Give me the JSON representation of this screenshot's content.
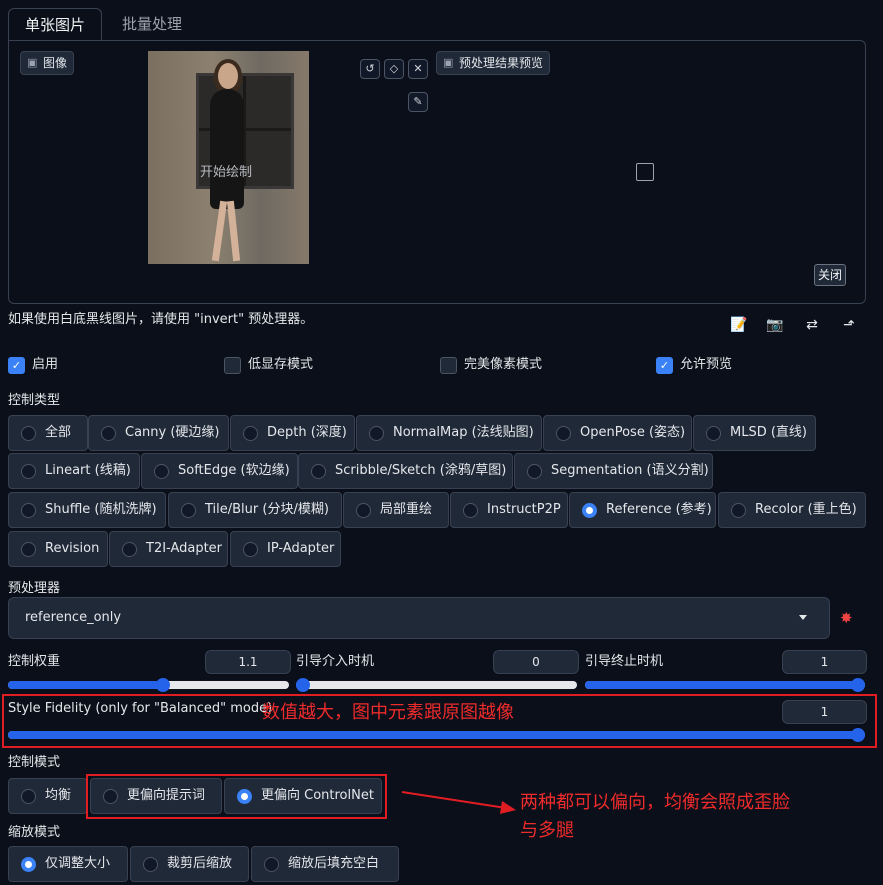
{
  "tabs": [
    "单张图片",
    "批量处理"
  ],
  "image_panel": {
    "label": "图像",
    "overlay_text": "开始绘制",
    "preview_label": "预处理结果预览",
    "close_label": "关闭"
  },
  "hint": "如果使用白底黑线图片，请使用 \"invert\" 预处理器。",
  "checkboxes": [
    {
      "label": "启用",
      "checked": true
    },
    {
      "label": "低显存模式",
      "checked": false
    },
    {
      "label": "完美像素模式",
      "checked": false
    },
    {
      "label": "允许预览",
      "checked": true
    }
  ],
  "control_type": {
    "label": "控制类型",
    "options": [
      "全部",
      "Canny (硬边缘)",
      "Depth (深度)",
      "NormalMap (法线贴图)",
      "OpenPose (姿态)",
      "MLSD (直线)",
      "Lineart (线稿)",
      "SoftEdge (软边缘)",
      "Scribble/Sketch (涂鸦/草图)",
      "Segmentation (语义分割)",
      "Shuffle (随机洗牌)",
      "Tile/Blur (分块/模糊)",
      "局部重绘",
      "InstructP2P",
      "Reference (参考)",
      "Recolor (重上色)",
      "Revision",
      "T2I-Adapter",
      "IP-Adapter"
    ],
    "selected": "Reference (参考)"
  },
  "preprocessor": {
    "label": "预处理器",
    "value": "reference_only"
  },
  "sliders": {
    "weight": {
      "label": "控制权重",
      "value": "1.1",
      "fraction": 0.55
    },
    "start": {
      "label": "引导介入时机",
      "value": "0",
      "fraction": 0.0
    },
    "end": {
      "label": "引导终止时机",
      "value": "1",
      "fraction": 1.0
    },
    "fidelity": {
      "label": "Style Fidelity (only for \"Balanced\" mode)",
      "value": "1",
      "fraction": 1.0
    }
  },
  "control_mode": {
    "label": "控制模式",
    "options": [
      "均衡",
      "更偏向提示词",
      "更偏向 ControlNet"
    ],
    "selected": "更偏向 ControlNet"
  },
  "resize_mode": {
    "label": "缩放模式",
    "options": [
      "仅调整大小",
      "裁剪后缩放",
      "缩放后填充空白"
    ],
    "selected": "仅调整大小"
  },
  "annotations": {
    "fidelity_note": "数值越大，图中元素跟原图越像",
    "mode_note_1": "两种都可以偏向，均衡会照成歪脸",
    "mode_note_2": "与多腿"
  },
  "colors": {
    "accent": "#3b82f6",
    "annotation_red": "#e11d24",
    "background": "#0b0f19"
  }
}
